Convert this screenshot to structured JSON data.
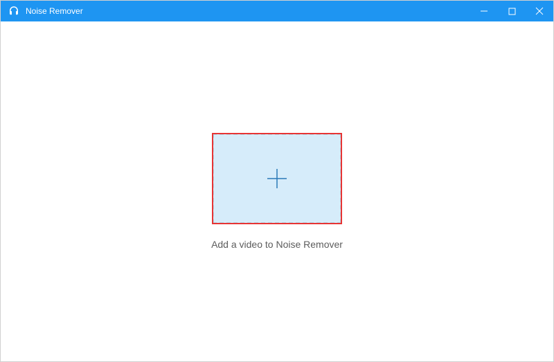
{
  "titlebar": {
    "app_name": "Noise Remover"
  },
  "main": {
    "instruction_text": "Add a video to Noise Remover"
  },
  "colors": {
    "titlebar_bg": "#1e95f2",
    "dropzone_bg": "#d6ecfa",
    "highlight_border": "#e73434",
    "plus_stroke": "#2a7ab8"
  }
}
